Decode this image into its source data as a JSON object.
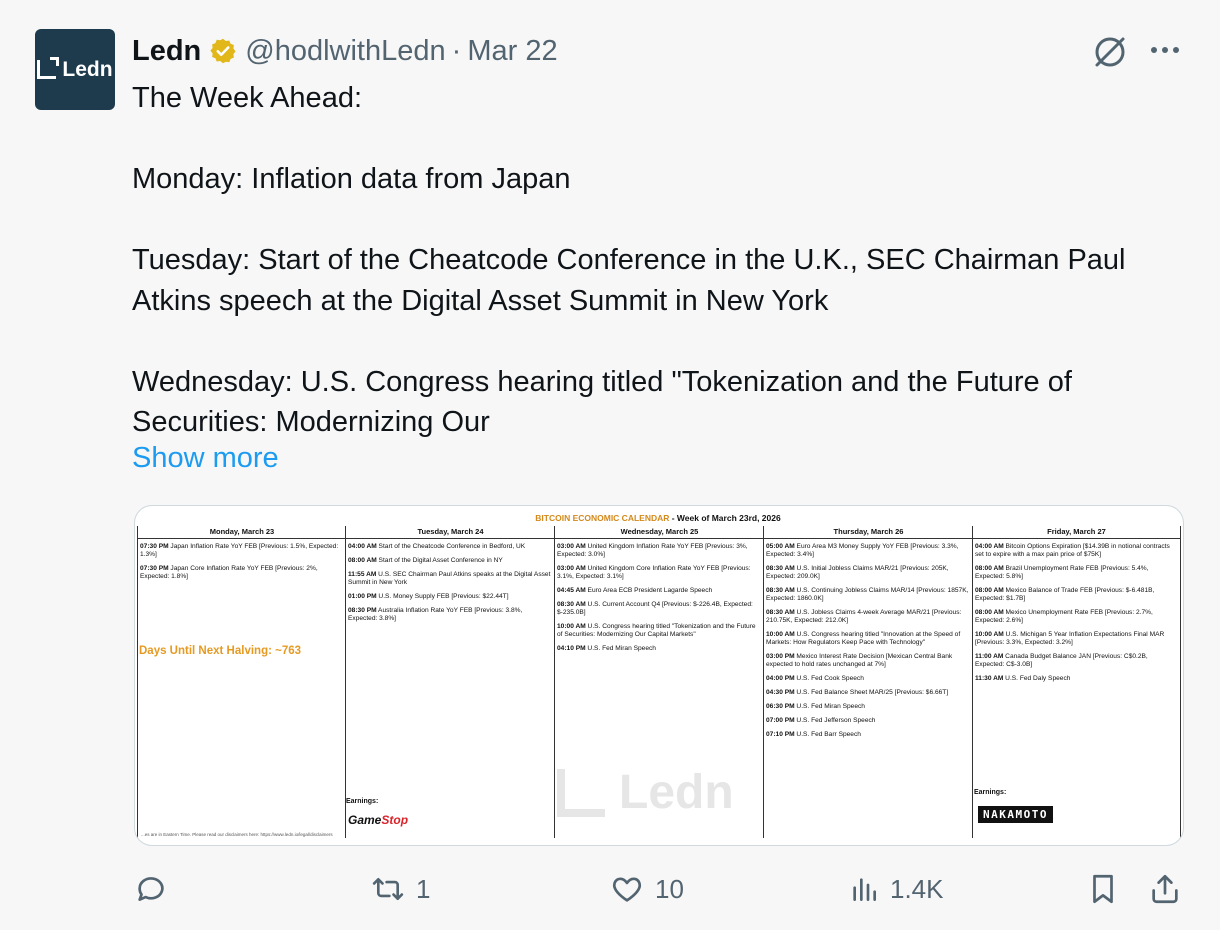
{
  "author": {
    "name": "Ledn",
    "handle": "@hodlwithLedn",
    "separator": "·",
    "date": "Mar 22",
    "avatar_text": "Ledn"
  },
  "tweet": {
    "lines": [
      "The Week Ahead:",
      "",
      "Monday: Inflation data from Japan",
      "",
      "Tuesday: Start of the Cheatcode Conference in the U.K., SEC Chairman Paul Atkins speech at the Digital Asset Summit in New York",
      "",
      "Wednesday: U.S. Congress hearing titled \"Tokenization and the Future of Securities: Modernizing Our"
    ],
    "show_more": "Show more"
  },
  "calendar": {
    "title_accent": "BITCOIN ECONOMIC CALENDAR",
    "title_rest": " - Week of March 23rd, 2026",
    "days": [
      {
        "header": "Monday, March 23",
        "items": [
          {
            "time": "07:30 PM",
            "text": " Japan Inflation Rate YoY FEB [Previous: 1.5%, Expected: 1.3%]"
          },
          {
            "time": "07:30 PM",
            "text": " Japan Core Inflation Rate YoY FEB [Previous: 2%, Expected: 1.8%]"
          }
        ]
      },
      {
        "header": "Tuesday, March 24",
        "items": [
          {
            "time": "04:00 AM",
            "text": " Start of the Cheatcode Conference in Bedford, UK"
          },
          {
            "time": "08:00 AM",
            "text": " Start of the Digital Asset Conference in NY"
          },
          {
            "time": "11:55 AM",
            "text": " U.S. SEC Chairman Paul Atkins speaks at the Digital Asset Summit in New York"
          },
          {
            "time": "01:00 PM",
            "text": " U.S. Money Supply FEB [Previous: $22.44T]"
          },
          {
            "time": "08:30 PM",
            "text": " Australia Inflation Rate YoY FEB [Previous: 3.8%, Expected: 3.8%]"
          }
        ]
      },
      {
        "header": "Wednesday, March 25",
        "items": [
          {
            "time": "03:00 AM",
            "text": " United Kingdom Inflation Rate YoY FEB [Previous: 3%, Expected: 3.0%]"
          },
          {
            "time": "03:00 AM",
            "text": " United Kingdom Core Inflation Rate YoY FEB [Previous: 3.1%, Expected: 3.1%]"
          },
          {
            "time": "04:45 AM",
            "text": " Euro Area ECB President Lagarde Speech"
          },
          {
            "time": "08:30 AM",
            "text": " U.S. Current Account Q4 [Previous: $-226.4B, Expected: $-235.0B]"
          },
          {
            "time": "10:00 AM",
            "text": " U.S. Congress hearing titled \"Tokenization and the Future of Securities: Modernizing Our Capital Markets\""
          },
          {
            "time": "04:10 PM",
            "text": " U.S. Fed Miran Speech"
          }
        ]
      },
      {
        "header": "Thursday, March 26",
        "items": [
          {
            "time": "05:00 AM",
            "text": " Euro Area M3 Money Supply YoY FEB [Previous: 3.3%, Expected: 3.4%]"
          },
          {
            "time": "08:30 AM",
            "text": " U.S. Initial Jobless Claims MAR/21 [Previous: 205K, Expected: 209.0K]"
          },
          {
            "time": "08:30 AM",
            "text": " U.S. Continuing Jobless Claims MAR/14 [Previous: 1857K, Expected: 1860.0K]"
          },
          {
            "time": "08:30 AM",
            "text": " U.S. Jobless Claims 4-week Average MAR/21 [Previous: 210.75K, Expected: 212.0K]"
          },
          {
            "time": "10:00 AM",
            "text": " U.S. Congress hearing titled \"Innovation at the Speed of Markets: How Regulators Keep Pace with Technology\""
          },
          {
            "time": "03:00 PM",
            "text": " Mexico Interest Rate Decision [Mexican Central Bank expected to hold rates unchanged at 7%]"
          },
          {
            "time": "04:00 PM",
            "text": " U.S. Fed Cook Speech"
          },
          {
            "time": "04:30 PM",
            "text": " U.S. Fed Balance Sheet MAR/25 [Previous: $6.66T]"
          },
          {
            "time": "06:30 PM",
            "text": " U.S. Fed Miran Speech"
          },
          {
            "time": "07:00 PM",
            "text": " U.S. Fed Jefferson Speech"
          },
          {
            "time": "07:10 PM",
            "text": " U.S. Fed Barr Speech"
          }
        ]
      },
      {
        "header": "Friday, March 27",
        "items": [
          {
            "time": "04:00 AM",
            "text": " Bitcoin Options Expiration [$14.39B in notional contracts set to expire with a max pain price of $75K]"
          },
          {
            "time": "08:00 AM",
            "text": " Brazil Unemployment Rate FEB [Previous: 5.4%, Expected: 5.8%]"
          },
          {
            "time": "08:00 AM",
            "text": " Mexico Balance of Trade FEB [Previous: $-6.481B, Expected: $1.7B]"
          },
          {
            "time": "08:00 AM",
            "text": " Mexico Unemployment Rate FEB [Previous: 2.7%, Expected: 2.6%]"
          },
          {
            "time": "10:00 AM",
            "text": " U.S. Michigan 5 Year Inflation Expectations Final MAR [Previous: 3.3%, Expected: 3.2%]"
          },
          {
            "time": "11:00 AM",
            "text": " Canada Budget Balance JAN [Previous: C$0.2B, Expected: C$-3.0B]"
          },
          {
            "time": "11:30 AM",
            "text": " U.S. Fed Daly Speech"
          }
        ]
      }
    ],
    "halving": "Days Until Next Halving: ~763",
    "earnings_label": "Earnings:",
    "gamestop_a": "Game",
    "gamestop_b": "Stop",
    "nakamoto": "NAKAMOTO",
    "watermark": "Ledn",
    "footnote": "...es are in Eastern Time. Please read our disclaimers here: https://www.ledn.io/legal/disclaimers"
  },
  "actions": {
    "reposts": "1",
    "likes": "10",
    "views": "1.4K"
  },
  "colors": {
    "link": "#1d9bf0",
    "muted": "#536471",
    "avatar_bg": "#1d3b4d",
    "accent": "#e69a22"
  }
}
